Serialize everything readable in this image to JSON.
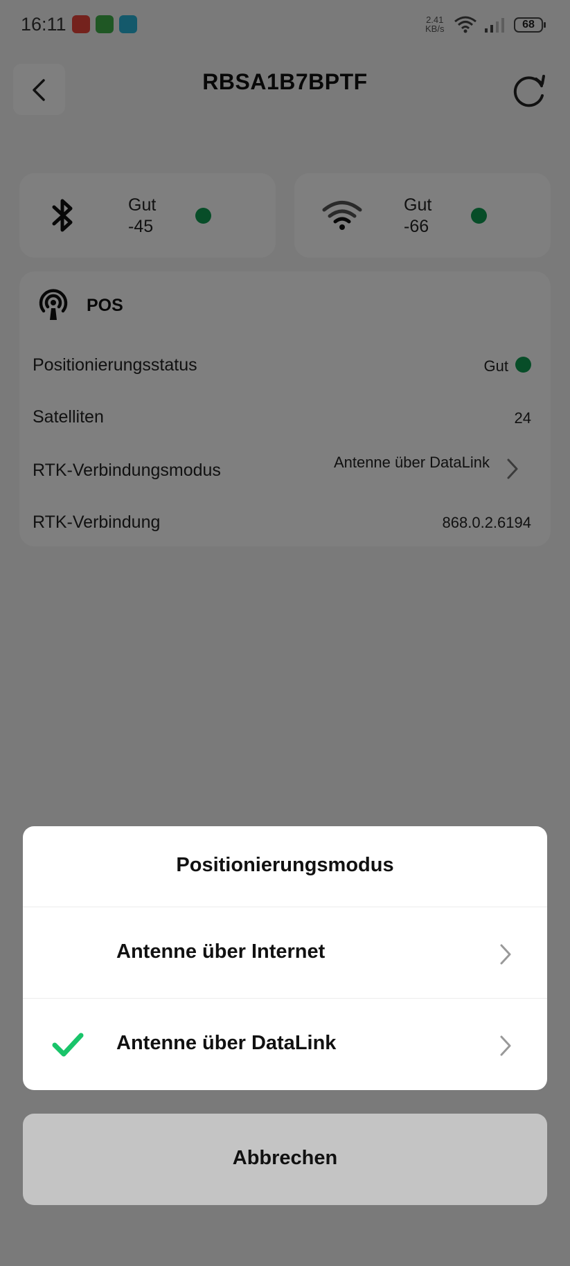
{
  "status_bar": {
    "time": "16:11",
    "net_speed_value": "2.41",
    "net_speed_unit": "KB/s",
    "battery": "68"
  },
  "header": {
    "title": "RBSA1B7BPTF",
    "back_icon": "chevron-left-icon",
    "refresh_icon": "refresh-icon"
  },
  "bluetooth": {
    "icon": "bluetooth-icon",
    "status": "Gut",
    "value": "-45",
    "color": "#0f9a50"
  },
  "wifi": {
    "icon": "wifi-icon",
    "status": "Gut",
    "value": "-66",
    "color": "#0f9a50"
  },
  "pos": {
    "icon": "antenna-icon",
    "title": "POS",
    "rows": [
      {
        "label": "Positionierungsstatus",
        "value": "Gut"
      },
      {
        "label": "Satelliten",
        "value": "24"
      },
      {
        "label": "RTK-Verbindungsmodus",
        "value": "Antenne über DataLink"
      },
      {
        "label": "RTK-Verbindung",
        "value": "868.0.2.6194"
      }
    ]
  },
  "dialog": {
    "title": "Positionierungsmodus",
    "options": [
      {
        "label": "Antenne über Internet",
        "selected": false
      },
      {
        "label": "Antenne über DataLink",
        "selected": true
      }
    ],
    "check_color": "#19c46a",
    "cancel_label": "Abbrechen"
  }
}
